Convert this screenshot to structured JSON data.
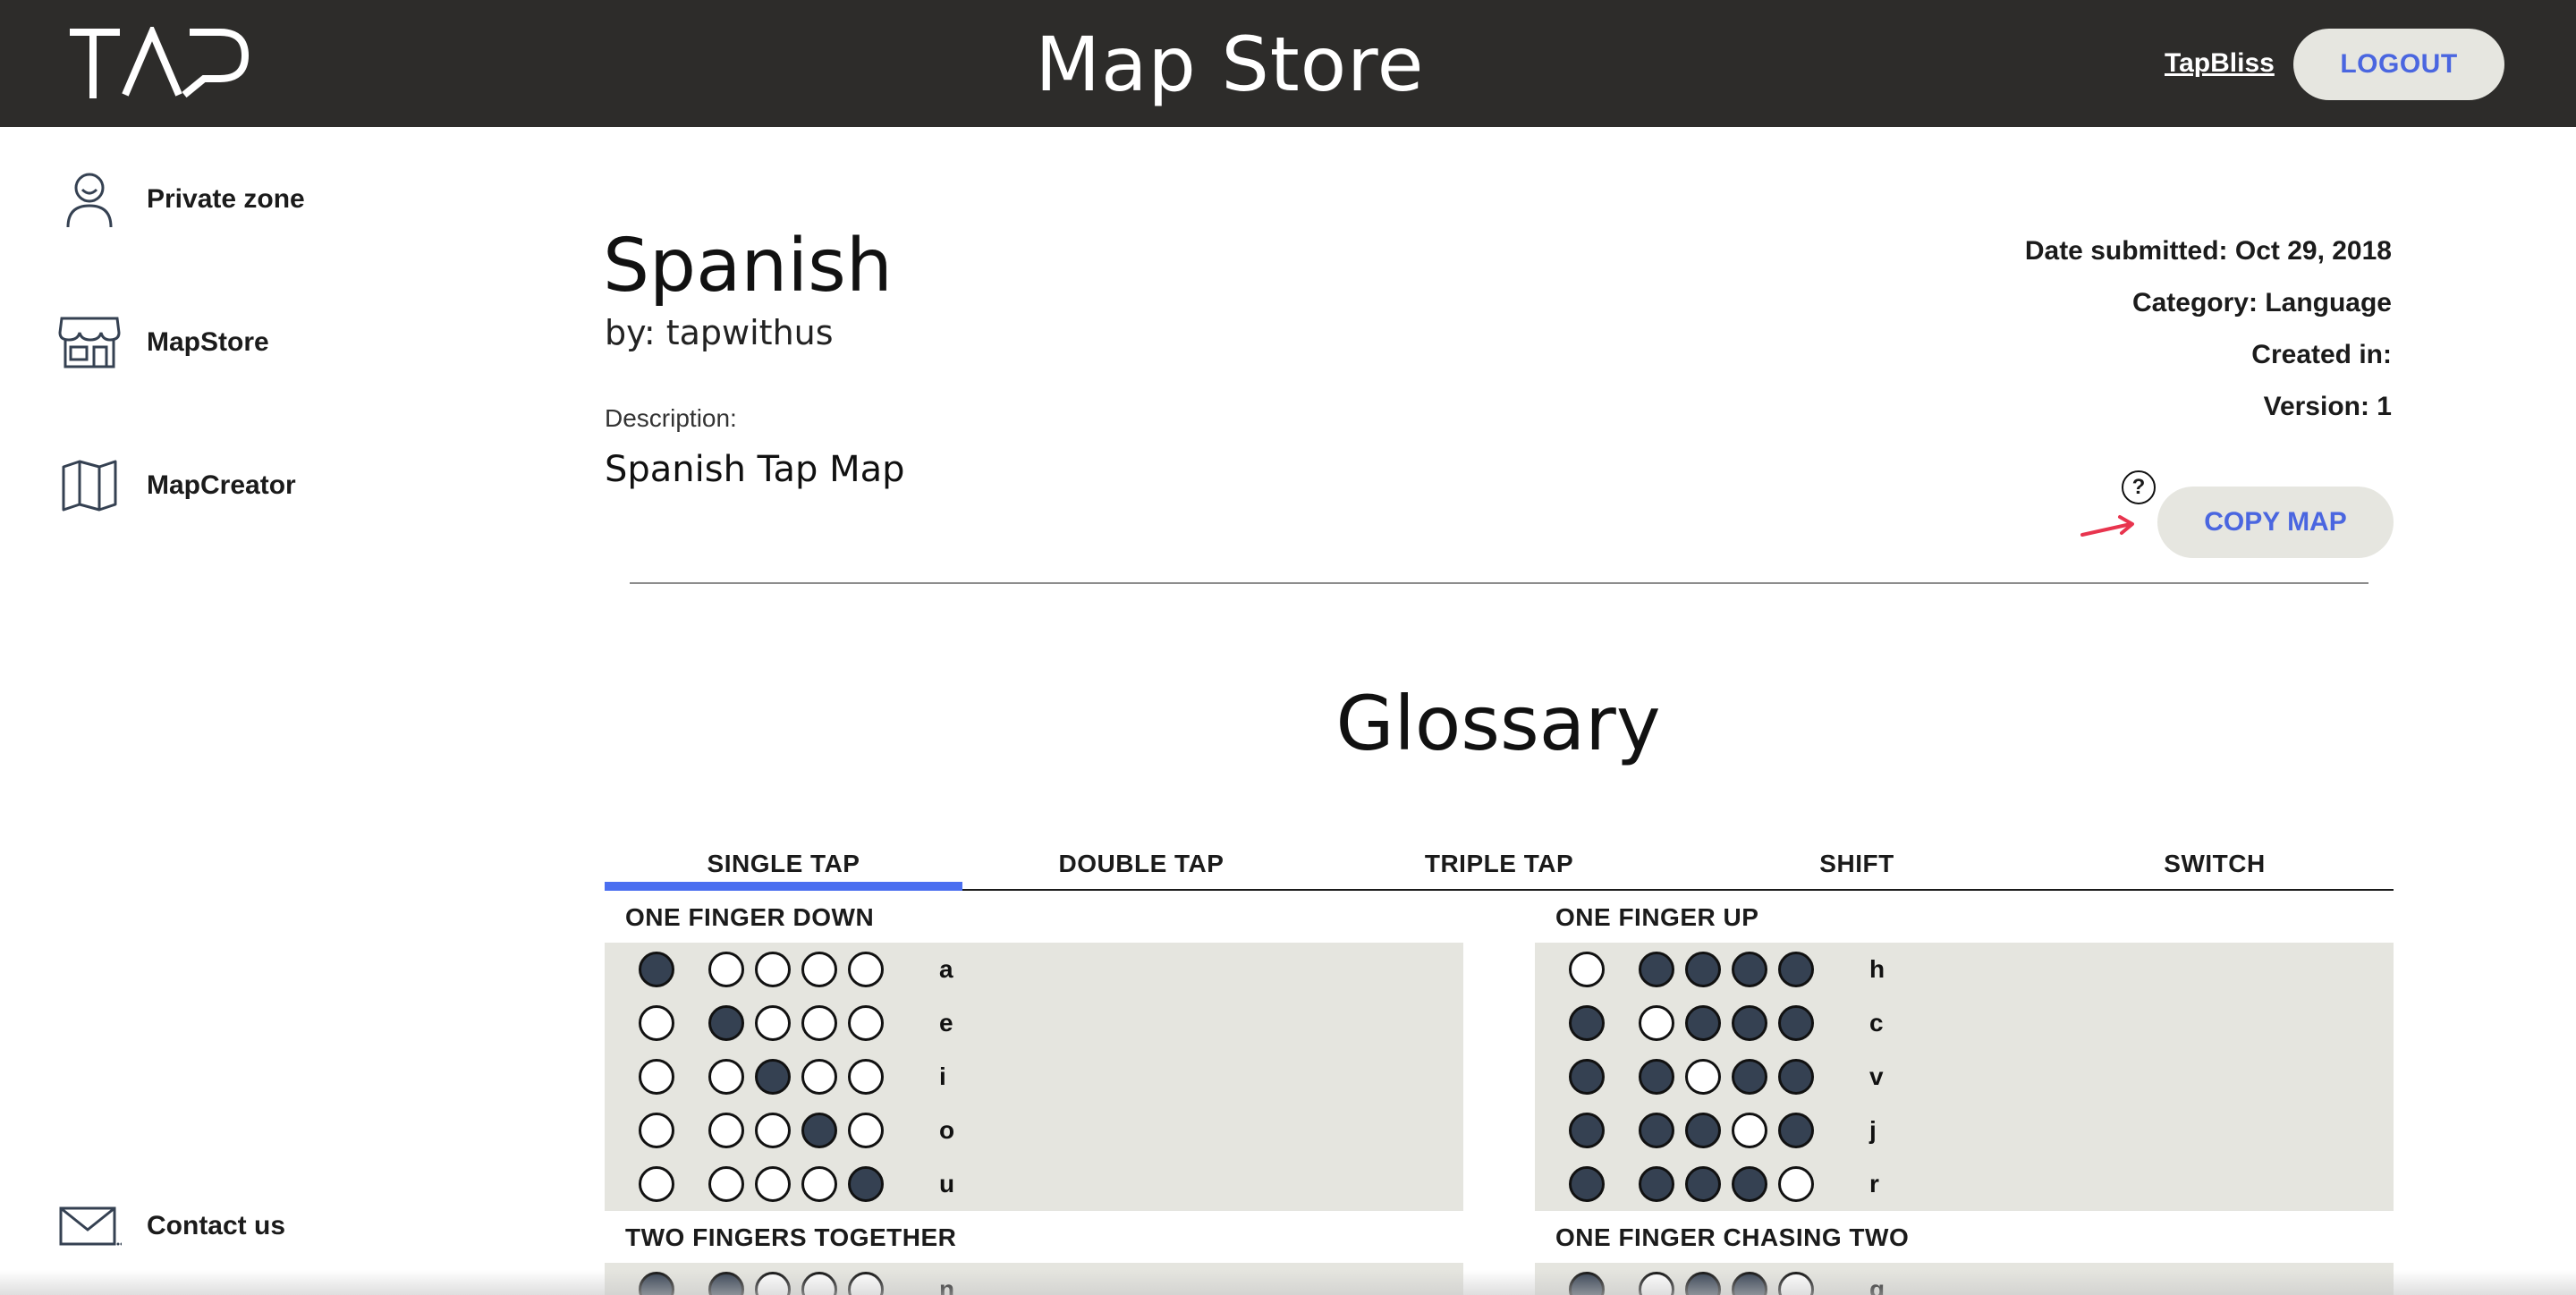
{
  "header": {
    "title": "Map Store",
    "user_link": "TapBliss",
    "logout_label": "LOGOUT"
  },
  "sidebar": {
    "items": [
      {
        "label": "Private zone",
        "icon": "user-icon"
      },
      {
        "label": "MapStore",
        "icon": "store-icon"
      },
      {
        "label": "MapCreator",
        "icon": "map-icon"
      }
    ],
    "contact": {
      "label": "Contact us",
      "icon": "mail-icon"
    }
  },
  "map": {
    "title": "Spanish",
    "author": "by: tapwithus",
    "description_label": "Description:",
    "description": "Spanish Tap Map",
    "date_submitted": "Date submitted: Oct 29, 2018",
    "category": "Category: Language",
    "created_in": "Created in:",
    "version": "Version: 1",
    "help_label": "?",
    "copy_label": "COPY MAP"
  },
  "glossary": {
    "title": "Glossary",
    "tabs": [
      "SINGLE TAP",
      "DOUBLE TAP",
      "TRIPLE TAP",
      "SHIFT",
      "SWITCH"
    ],
    "active_tab": "SINGLE TAP",
    "groups": [
      {
        "title": "ONE FINGER DOWN",
        "rows": [
          {
            "fingers": [
              1,
              0,
              0,
              0,
              0
            ],
            "letter": "a"
          },
          {
            "fingers": [
              0,
              1,
              0,
              0,
              0
            ],
            "letter": "e"
          },
          {
            "fingers": [
              0,
              0,
              1,
              0,
              0
            ],
            "letter": "i"
          },
          {
            "fingers": [
              0,
              0,
              0,
              1,
              0
            ],
            "letter": "o"
          },
          {
            "fingers": [
              0,
              0,
              0,
              0,
              1
            ],
            "letter": "u"
          }
        ]
      },
      {
        "title": "ONE FINGER UP",
        "rows": [
          {
            "fingers": [
              0,
              1,
              1,
              1,
              1
            ],
            "letter": "h"
          },
          {
            "fingers": [
              1,
              0,
              1,
              1,
              1
            ],
            "letter": "c"
          },
          {
            "fingers": [
              1,
              1,
              0,
              1,
              1
            ],
            "letter": "v"
          },
          {
            "fingers": [
              1,
              1,
              1,
              0,
              1
            ],
            "letter": "j"
          },
          {
            "fingers": [
              1,
              1,
              1,
              1,
              0
            ],
            "letter": "r"
          }
        ]
      },
      {
        "title": "TWO FINGERS TOGETHER",
        "rows": [
          {
            "fingers": [
              1,
              1,
              0,
              0,
              0
            ],
            "letter": "n"
          }
        ]
      },
      {
        "title": "ONE FINGER CHASING TWO",
        "rows": [
          {
            "fingers": [
              1,
              0,
              1,
              1,
              0
            ],
            "letter": "g"
          }
        ]
      }
    ]
  },
  "colors": {
    "header_bg": "#2d2c2a",
    "accent": "#4b6ff0",
    "button_bg": "#e6e6e0",
    "panel_bg": "#e5e5df",
    "finger_on": "#354152",
    "arrow": "#e8344e"
  }
}
